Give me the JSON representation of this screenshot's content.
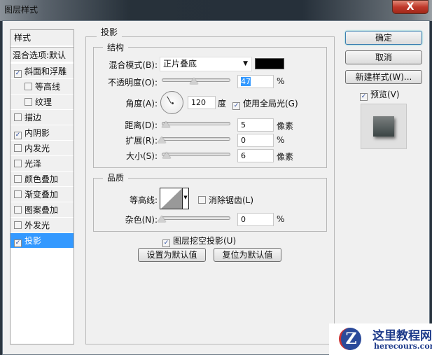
{
  "window": {
    "title": "图层样式",
    "close": "X"
  },
  "sidebar": {
    "header": "样式",
    "blend_options": "混合选项:默认",
    "items": [
      {
        "label": "斜面和浮雕",
        "checked": true
      },
      {
        "label": "等高线",
        "checked": false
      },
      {
        "label": "纹理",
        "checked": false
      },
      {
        "label": "描边",
        "checked": false
      },
      {
        "label": "内阴影",
        "checked": true
      },
      {
        "label": "内发光",
        "checked": false
      },
      {
        "label": "光泽",
        "checked": false
      },
      {
        "label": "颜色叠加",
        "checked": false
      },
      {
        "label": "渐变叠加",
        "checked": false
      },
      {
        "label": "图案叠加",
        "checked": false
      },
      {
        "label": "外发光",
        "checked": false
      },
      {
        "label": "投影",
        "checked": true
      }
    ]
  },
  "panel": {
    "title": "投影",
    "structure": {
      "title": "结构",
      "blend_mode_label": "混合模式(B):",
      "blend_mode": "正片叠底",
      "shadow_color": "#000000",
      "opacity_label": "不透明度(O):",
      "opacity": "47",
      "opacity_unit": "%",
      "angle_label": "角度(A):",
      "angle": "120",
      "angle_unit": "度",
      "global_light_label": "使用全局光(G)",
      "global_light": true,
      "distance_label": "距离(D):",
      "distance": "5",
      "distance_unit": "像素",
      "spread_label": "扩展(R):",
      "spread": "0",
      "spread_unit": "%",
      "size_label": "大小(S):",
      "size": "6",
      "size_unit": "像素"
    },
    "quality": {
      "title": "品质",
      "contour_label": "等高线:",
      "antialias_label": "消除锯齿(L)",
      "antialias": false,
      "noise_label": "杂色(N):",
      "noise": "0",
      "noise_unit": "%"
    },
    "knockout_label": "图层挖空投影(U)",
    "knockout": true,
    "make_default": "设置为默认值",
    "reset_default": "复位为默认值"
  },
  "buttons": {
    "ok": "确定",
    "cancel": "取消",
    "new_style": "新建样式(W)...",
    "preview_label": "预览(V)",
    "preview": true
  },
  "watermark": {
    "name": "这里教程网",
    "url": "herecours.com"
  }
}
